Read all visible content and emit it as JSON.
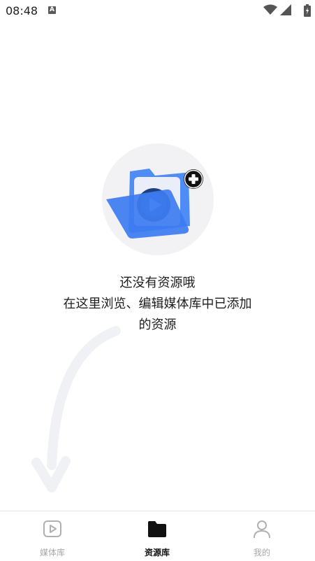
{
  "status_bar": {
    "time": "08:48",
    "notification_icon_letter": "A"
  },
  "empty_state": {
    "title": "还没有资源哦",
    "description_lines": [
      "在这里浏览、编辑媒体库中已添加",
      "的资源"
    ]
  },
  "bottom_nav": {
    "items": [
      {
        "label": "媒体库",
        "icon": "play-square-icon",
        "active": false
      },
      {
        "label": "资源库",
        "icon": "folder-icon",
        "active": true
      },
      {
        "label": "我的",
        "icon": "person-icon",
        "active": false
      }
    ]
  },
  "colors": {
    "folder_blue": "#3d7cf0",
    "inactive": "#a8a8a8",
    "active": "#111111"
  }
}
